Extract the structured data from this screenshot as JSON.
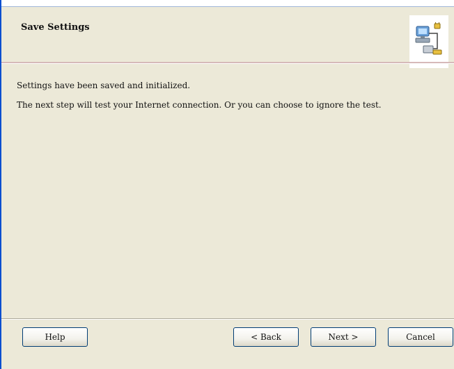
{
  "header": {
    "title": "Save Settings",
    "icon": "network-computer-icon"
  },
  "content": {
    "line1": "Settings have been saved and initialized.",
    "line2": "The next step will test your Internet connection. Or you can choose to ignore the test."
  },
  "buttons": {
    "help": "Help",
    "back": "< Back",
    "next": "Next >",
    "cancel": "Cancel"
  },
  "colors": {
    "background": "#ece9d8",
    "window_border": "#0a4fcf",
    "button_border": "#003c74"
  }
}
